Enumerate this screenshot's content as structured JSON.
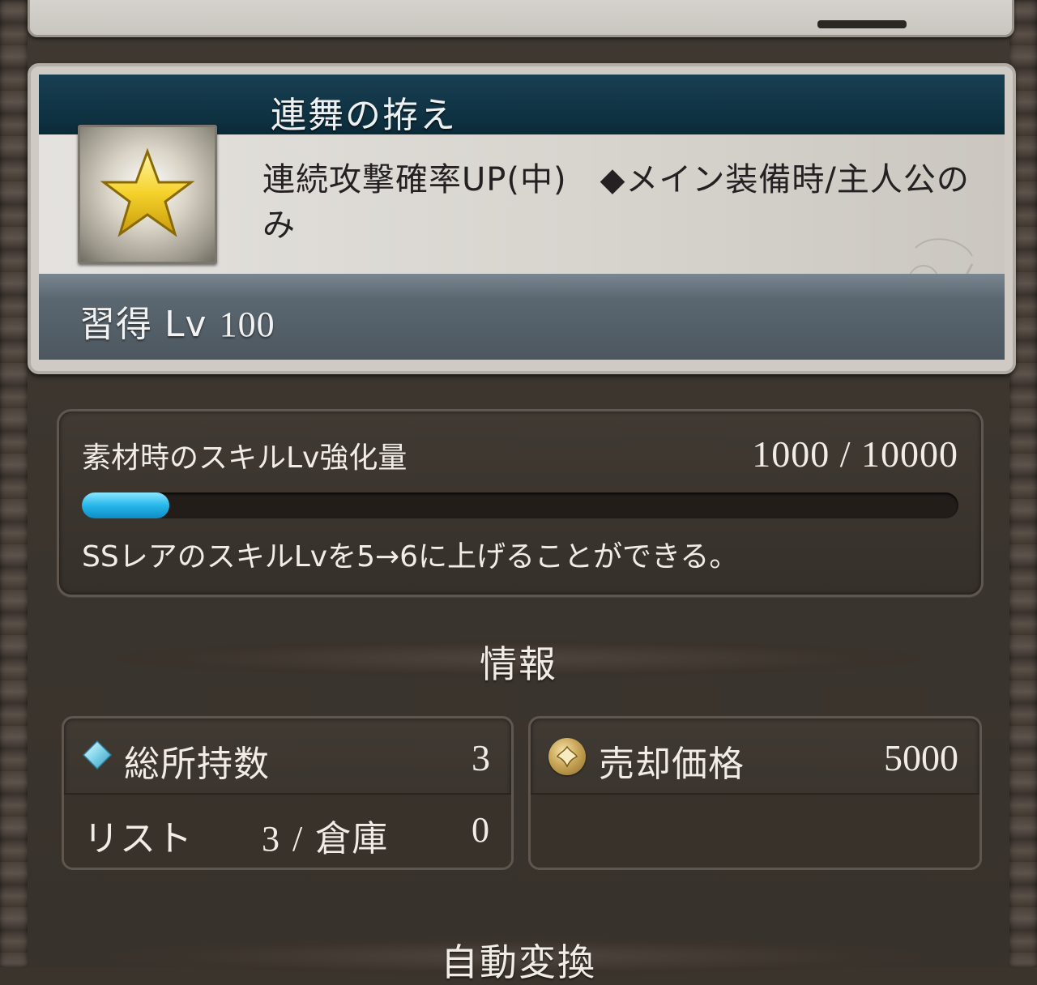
{
  "skill": {
    "name": "連舞の拵え",
    "description": "連続攻撃確率UP(中)　◆メイン装備時/主人公のみ",
    "acquire_label": "習得",
    "acquire_lv_prefix": "Lv",
    "acquire_lv": "100"
  },
  "skill_lv_boost": {
    "label": "素材時のスキルLv強化量",
    "value": "1000 / 10000",
    "progress_fraction": 0.1,
    "note": "SSレアのスキルLvを5→6に上げることができる。"
  },
  "sections": {
    "info": "情報",
    "auto_convert": "自動変換"
  },
  "info": {
    "owned_label": "総所持数",
    "owned_value": "3",
    "list_label": "リスト",
    "list_value": "3",
    "separator": "/",
    "storage_label": "倉庫",
    "storage_value": "0",
    "sell_label": "売却価格",
    "sell_value": "5000"
  },
  "icons": {
    "skill": "star-icon",
    "owned": "diamond-icon",
    "sell": "coin-icon"
  },
  "colors": {
    "title_bar": "#0f3242",
    "progress": "#26b7ea",
    "star": "#f5d22b"
  }
}
